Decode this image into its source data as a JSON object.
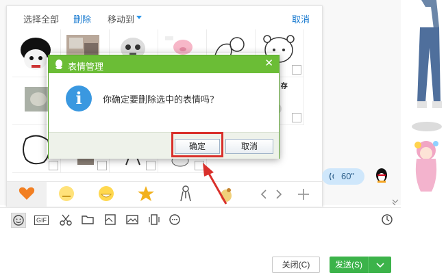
{
  "panel": {
    "select_all": "选择全部",
    "delete": "删除",
    "move_to": "移动到",
    "cancel": "取消"
  },
  "stickers": [
    {
      "name": "sticker-mushroom-head",
      "text": ""
    },
    {
      "name": "sticker-photo-collage",
      "text": ""
    },
    {
      "name": "sticker-panda-face",
      "text": ""
    },
    {
      "name": "sticker-pink-pig",
      "text": ""
    },
    {
      "name": "sticker-line-drawing",
      "text": ""
    },
    {
      "name": "sticker-bear-outline",
      "text": ""
    },
    {
      "name": "sticker-cat-photo",
      "text": ""
    },
    {
      "name": "sticker-meme-text",
      "text": "的腰里 存钱"
    },
    {
      "name": "sticker-white-blob",
      "text": ""
    },
    {
      "name": "sticker-small-figure",
      "text": ""
    },
    {
      "name": "sticker-stick-figure",
      "text": ""
    },
    {
      "name": "sticker-face",
      "text": ""
    }
  ],
  "tabs": [
    "heart",
    "smiley-plain",
    "smiley-grin",
    "star",
    "figure",
    "squirrel"
  ],
  "voice_bubble": {
    "duration": "60\""
  },
  "toolbar_icons": [
    "smiley-icon",
    "gif-icon",
    "scissors-icon",
    "folder-icon",
    "image-tool-icon",
    "picture-icon",
    "shake-icon",
    "more-icon",
    "clock-icon"
  ],
  "gif_label": "GIF",
  "bottom": {
    "close_label": "关闭(C)",
    "send_label": "发送(S)"
  },
  "modal": {
    "title": "表情管理",
    "message": "你确定要删除选中的表情吗？",
    "confirm": "确定",
    "cancel": "取消",
    "info_glyph": "i"
  },
  "colors": {
    "accent_green": "#6bbd36",
    "link_blue": "#1a7bd0",
    "highlight_red": "#d9302b",
    "send_green": "#3cb34a"
  }
}
